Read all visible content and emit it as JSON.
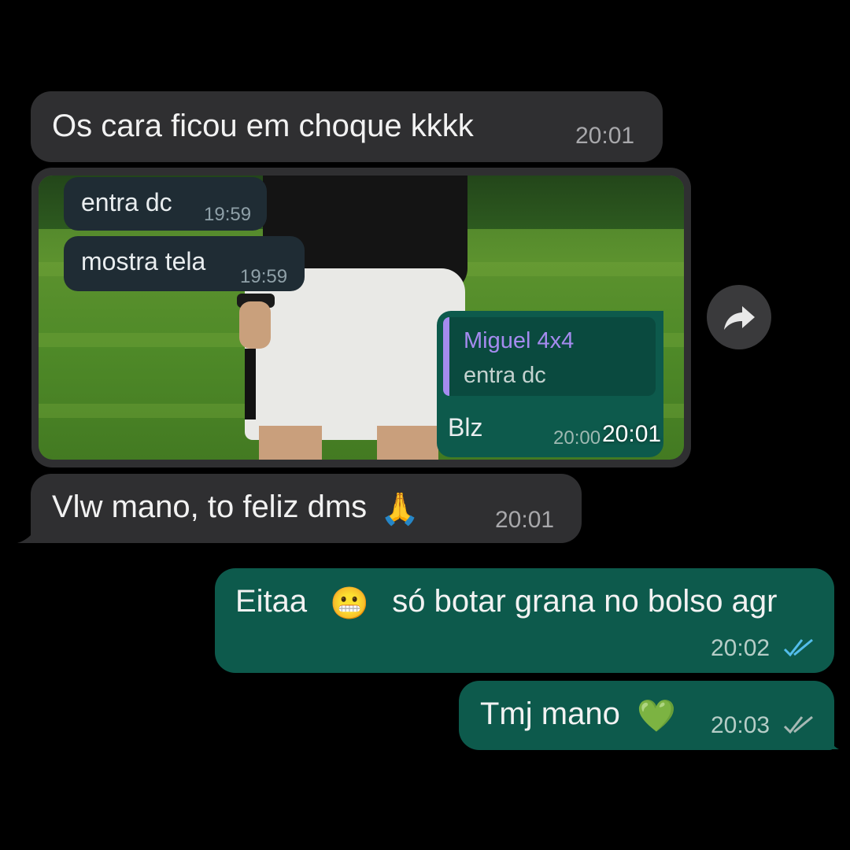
{
  "messages": {
    "m1": {
      "text": "Os cara ficou em choque kkkk",
      "time": "20:01"
    },
    "photo": {
      "time": "20:01",
      "screenshot": {
        "b1": {
          "text": "entra dc",
          "time": "19:59"
        },
        "b2": {
          "text": "mostra tela",
          "time": "19:59"
        },
        "reply": {
          "quote_author": "Miguel 4x4",
          "quote_text": "entra dc",
          "text": "Blz",
          "time": "20:00"
        }
      }
    },
    "m2": {
      "text": "Vlw mano, to feliz dms",
      "emoji": "🙏",
      "time": "20:01"
    },
    "m3": {
      "text_a": "Eitaa",
      "emoji": "😬",
      "text_b": "só botar grana no bolso agr",
      "time": "20:02",
      "status": "read"
    },
    "m4": {
      "text": "Tmj mano",
      "emoji": "💚",
      "time": "20:03",
      "status": "delivered"
    }
  },
  "icons": {
    "forward": "forward-arrow-icon",
    "read_ticks": "double-check-icon",
    "delivered_ticks": "double-check-icon"
  },
  "colors": {
    "incoming": "#2f2f31",
    "outgoing": "#0d5a4c",
    "read_tick": "#53bdeb",
    "delivered_tick": "#a7b8b4",
    "quote_bar": "#a58bef"
  }
}
